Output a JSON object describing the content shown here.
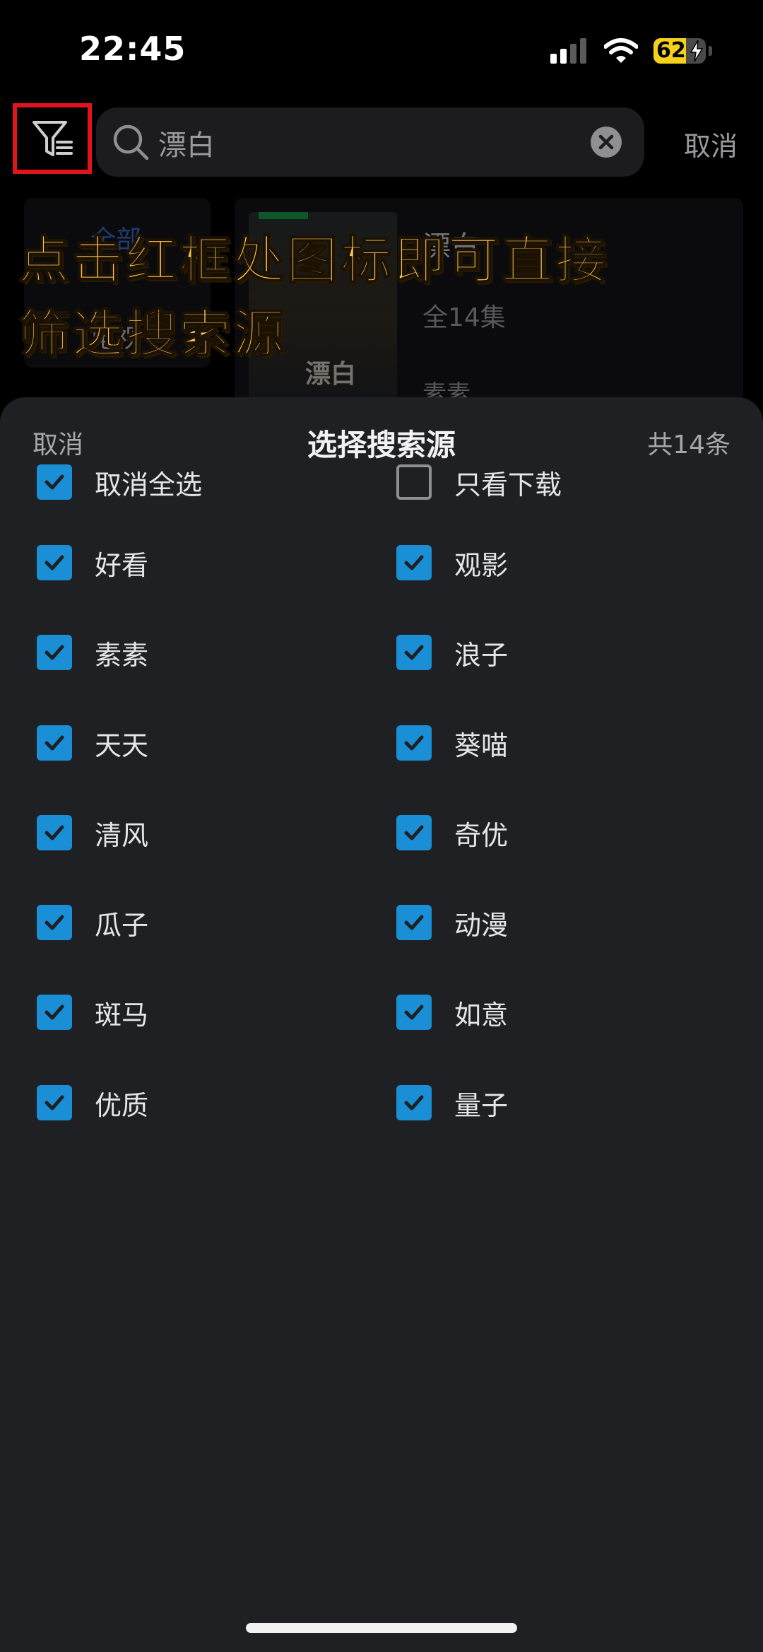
{
  "status_bar": {
    "time": "22:45",
    "battery_level": "62",
    "battery_fraction": 0.62,
    "battery_color": "#f5d11a"
  },
  "header": {
    "search_value": "漂白",
    "cancel_label": "取消",
    "filter_highlight_color": "#e0141c"
  },
  "background": {
    "categories": [
      "全部",
      "电视"
    ],
    "result": {
      "poster_text": "漂白",
      "title": "漂白",
      "episodes": "全14集",
      "source": "素素"
    }
  },
  "annotation": {
    "line1": "点击红框处图标即可直接",
    "line2": "筛选搜索源",
    "color": "#ffc34e"
  },
  "sheet": {
    "cancel_label": "取消",
    "title": "选择搜索源",
    "count_label": "共14条",
    "accent_color": "#1a8fd6",
    "options": [
      {
        "label": "取消全选",
        "checked": true
      },
      {
        "label": "只看下载",
        "checked": false
      },
      {
        "label": "好看",
        "checked": true
      },
      {
        "label": "观影",
        "checked": true
      },
      {
        "label": "素素",
        "checked": true
      },
      {
        "label": "浪子",
        "checked": true
      },
      {
        "label": "天天",
        "checked": true
      },
      {
        "label": "葵喵",
        "checked": true
      },
      {
        "label": "清风",
        "checked": true
      },
      {
        "label": "奇优",
        "checked": true
      },
      {
        "label": "瓜子",
        "checked": true
      },
      {
        "label": "动漫",
        "checked": true
      },
      {
        "label": "斑马",
        "checked": true
      },
      {
        "label": "如意",
        "checked": true
      },
      {
        "label": "优质",
        "checked": true
      },
      {
        "label": "量子",
        "checked": true
      }
    ]
  }
}
